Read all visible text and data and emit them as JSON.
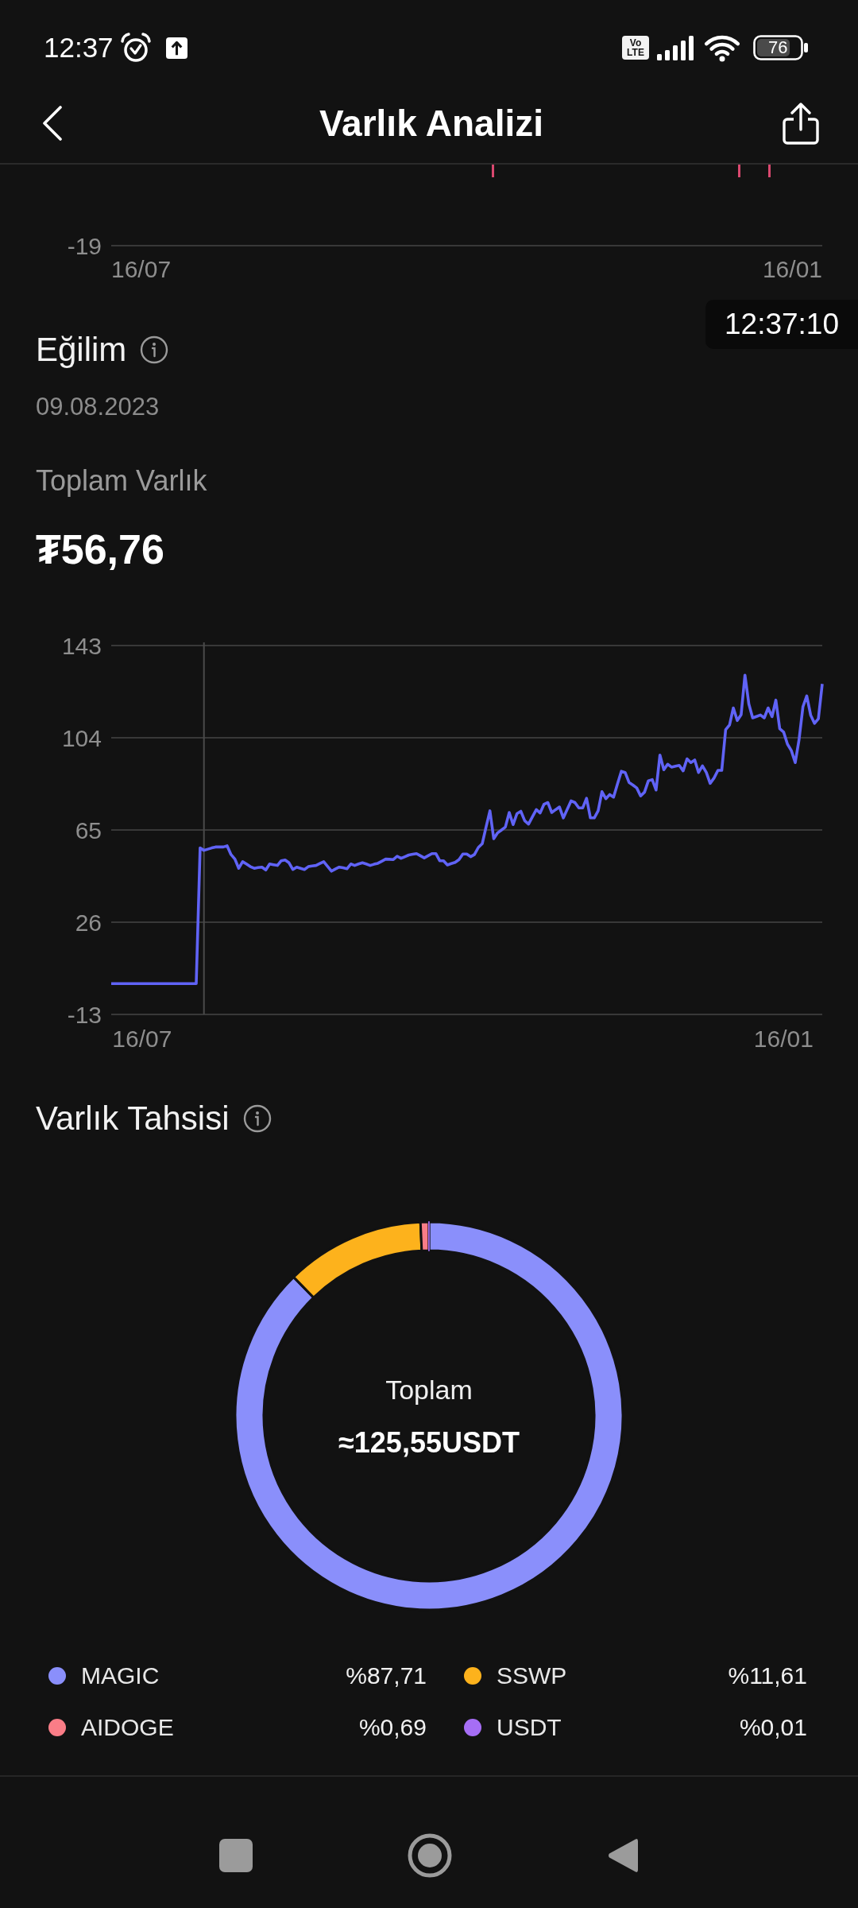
{
  "status_bar": {
    "time": "12:37",
    "network_badge": "Vo LTE",
    "battery": "76"
  },
  "header": {
    "title": "Varlık Analizi"
  },
  "top_chart": {
    "y_axis_label": "-19",
    "x_axis_labels": [
      "16/07",
      "16/01"
    ]
  },
  "time_tooltip": "12:37:10",
  "trend": {
    "title": "Eğilim",
    "date": "09.08.2023",
    "total_label": "Toplam Varlık",
    "total_value": "₮56,76",
    "chart_data": {
      "type": "line",
      "grid": true,
      "categories": [
        null,
        null,
        null,
        null,
        null,
        null,
        null,
        null,
        "16/07",
        null,
        null,
        null,
        null,
        null,
        null,
        null,
        null,
        null,
        null,
        null,
        null,
        null,
        null,
        null,
        null,
        null,
        null,
        null,
        null,
        null,
        null,
        null,
        null,
        null,
        null,
        null,
        null,
        null,
        null,
        null,
        null,
        null,
        null,
        null,
        null,
        null,
        null,
        null,
        null,
        null,
        null,
        null,
        null,
        null,
        null,
        null,
        null,
        null,
        null,
        null,
        null,
        null,
        null,
        null,
        null,
        null,
        null,
        null,
        null,
        null,
        null,
        null,
        null,
        null,
        null,
        null,
        null,
        null,
        null,
        null,
        null,
        null,
        null,
        null,
        null,
        null,
        null,
        null,
        null,
        null,
        null,
        null,
        null,
        null,
        null,
        null,
        null,
        null,
        null,
        null,
        null,
        null,
        null,
        null,
        null,
        null,
        null,
        null,
        null,
        null,
        null,
        null,
        null,
        null,
        null,
        null,
        null,
        null,
        null,
        null,
        null,
        null,
        null,
        null,
        null,
        null,
        null,
        null,
        null,
        null,
        null,
        null,
        null,
        null,
        null,
        null,
        null,
        null,
        null,
        null,
        null,
        null,
        null,
        null,
        null,
        null,
        null,
        null,
        null,
        null,
        null,
        null,
        null,
        null,
        null,
        null,
        null,
        null,
        null,
        null,
        null,
        null,
        null,
        null,
        null,
        null,
        null,
        null,
        null,
        null,
        null,
        null,
        null,
        null,
        "16/01",
        null,
        null,
        null,
        null,
        null,
        null,
        null,
        null,
        null,
        null
      ],
      "series": [
        {
          "color": "#6063f6",
          "values": [
            0,
            0,
            0,
            0,
            0,
            0,
            0,
            0,
            0,
            0,
            0,
            0,
            0,
            0,
            0,
            0,
            0,
            0,
            0,
            0,
            0,
            0,
            0,
            57.4,
            56.4,
            56.9,
            57.4,
            57.8,
            57.8,
            57.8,
            58.3,
            54.6,
            52.7,
            48.8,
            51.6,
            50.6,
            49.5,
            48.8,
            49.1,
            49.3,
            48.1,
            50.6,
            50.3,
            50,
            52,
            52.3,
            51.1,
            48.3,
            49.3,
            48.8,
            48.3,
            49.5,
            49.8,
            50,
            50.8,
            51.6,
            49.6,
            47.6,
            48.5,
            49.3,
            49,
            48.6,
            50.6,
            50,
            50.6,
            51.1,
            50.6,
            50,
            50.5,
            50.9,
            51.8,
            52.7,
            52.6,
            52.5,
            53.9,
            53,
            53.7,
            54.4,
            54.7,
            55,
            54.1,
            53.2,
            54.1,
            55,
            55,
            52,
            52,
            50.2,
            50.8,
            51.3,
            52.5,
            54.8,
            54.8,
            53.7,
            54.6,
            57.6,
            59.2,
            66.2,
            73.1,
            61.3,
            63.8,
            65,
            66.2,
            72.4,
            67.3,
            71.9,
            72.9,
            68.9,
            67.5,
            70.6,
            73.6,
            72.2,
            75.9,
            76.6,
            72.4,
            73.6,
            74.7,
            70.1,
            73.7,
            77.3,
            76.6,
            74.3,
            74.3,
            78.4,
            70.1,
            70.1,
            73.1,
            81.2,
            78.2,
            80,
            78.9,
            84.4,
            89.8,
            89.3,
            85.1,
            84,
            82.8,
            79.4,
            81,
            85.8,
            86.3,
            81.9,
            96.7,
            90.5,
            92.8,
            91.6,
            92,
            92.3,
            90,
            95.1,
            93.5,
            94.6,
            89.3,
            92.1,
            89.3,
            84.7,
            87,
            90.2,
            90.2,
            107.4,
            109.4,
            116.6,
            111.3,
            113.8,
            130.5,
            118.3,
            112.4,
            113,
            113.6,
            112.4,
            116.6,
            112.9,
            119.9,
            107.8,
            106.4,
            101.3,
            98.6,
            93.5,
            103.2,
            117.1,
            121.7,
            113.6,
            110.1,
            112,
            126.8
          ]
        }
      ],
      "ylim": [
        -13,
        143
      ],
      "yticks": [
        -13,
        26,
        65,
        104,
        143
      ]
    }
  },
  "allocation": {
    "title": "Varlık Tahsisi",
    "center_label": "Toplam",
    "center_value": "≈125,55USDT",
    "chart_data": {
      "type": "donut",
      "categories": [
        "MAGIC",
        "SSWP",
        "AIDOGE",
        "USDT"
      ],
      "values": [
        87.71,
        11.61,
        0.69,
        0.01
      ]
    },
    "legend": [
      {
        "share": "%87,71",
        "color": "#8a8ffb"
      },
      {
        "share": "%11,61",
        "color": "#fdb21c"
      },
      {
        "share": "%0,69",
        "color": "#fa7d87"
      },
      {
        "share": "%0,01",
        "color": "#a66ef5"
      }
    ]
  }
}
